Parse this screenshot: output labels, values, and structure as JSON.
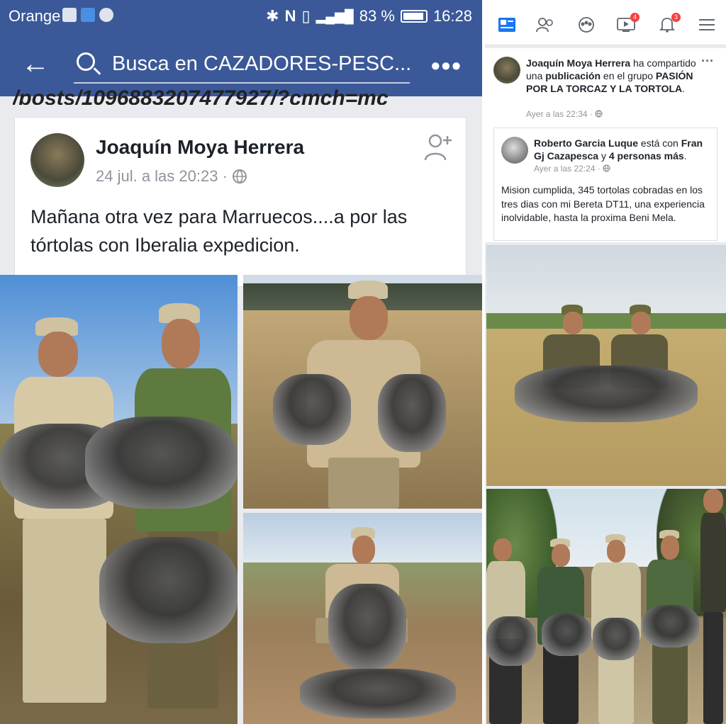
{
  "left": {
    "status_bar": {
      "carrier": "Orange",
      "battery": "83 %",
      "time": "16:28"
    },
    "search": {
      "back_icon": "arrow-left-icon",
      "search_icon": "search-icon",
      "placeholder": "Busca en CAZADORES-PESC...",
      "more_icon": "more-dots-icon"
    },
    "url_fragment": "/posts/1096883207477927/?cmch=mc",
    "post": {
      "author": "Joaquín Moya Herrera",
      "date": "24 jul. a las 20:23 · ",
      "privacy_icon": "globe-icon",
      "add_friend_icon": "add-friend-icon",
      "text": "Mañana otra vez para Marruecos....a por las tórtolas con Iberalia expedicion."
    }
  },
  "right": {
    "nav": {
      "icons": [
        "news-feed-icon",
        "friends-icon",
        "groups-icon",
        "watch-icon",
        "notifications-icon",
        "menu-icon"
      ],
      "watch_badge": "4",
      "notifications_badge": "3"
    },
    "share": {
      "actor": "Joaquín Moya Herrera",
      "verb1": " ha compartido una ",
      "object": "publicación",
      "verb2": " en el grupo ",
      "group": "PASIÓN POR LA TORCAZ Y LA TORTOLA",
      "end": ".",
      "date": "Ayer a las 22:34 · ",
      "more": "···"
    },
    "inner_post": {
      "author": "Roberto Garcia Luque",
      "with": " está con ",
      "tagged": "Fran Gj Cazapesca",
      "and": " y ",
      "others": "4 personas más",
      "end": ".",
      "date": "Ayer a las 22:24 · ",
      "text": "Mision cumplida, 345 tortolas cobradas en los tres dias con  mi Bereta DT11, una experiencia inolvidable, hasta  la proxima Beni Mela."
    }
  }
}
